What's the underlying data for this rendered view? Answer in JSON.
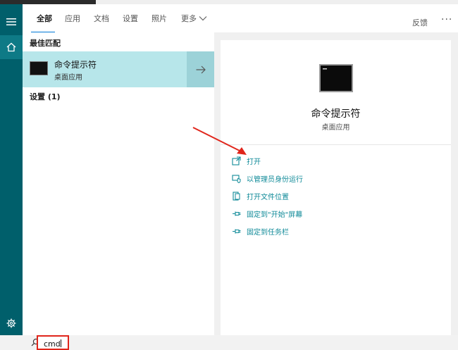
{
  "tabs": [
    {
      "label": "全部",
      "active": true
    },
    {
      "label": "应用"
    },
    {
      "label": "文档"
    },
    {
      "label": "设置"
    },
    {
      "label": "照片"
    },
    {
      "label": "更多"
    }
  ],
  "header": {
    "feedback_label": "反馈",
    "more_options": "···"
  },
  "results": {
    "best_match_label": "最佳匹配",
    "best": {
      "name": "命令提示符",
      "subtitle": "桌面应用"
    },
    "settings_label": "设置 (1)"
  },
  "detail": {
    "title": "命令提示符",
    "subtitle": "桌面应用",
    "actions": [
      {
        "label": "打开",
        "icon": "open-icon"
      },
      {
        "label": "以管理员身份运行",
        "icon": "shield-icon"
      },
      {
        "label": "打开文件位置",
        "icon": "file-location-icon"
      },
      {
        "label": "固定到\"开始\"屏幕",
        "icon": "pin-icon"
      },
      {
        "label": "固定到任务栏",
        "icon": "pin-icon"
      }
    ]
  },
  "search": {
    "value": "cmd"
  },
  "colors": {
    "accent": "#0078d7",
    "rail": "#005f6b",
    "highlight": "#b7e6ea",
    "action": "#0f8a98",
    "annotation": "#e0251b"
  }
}
